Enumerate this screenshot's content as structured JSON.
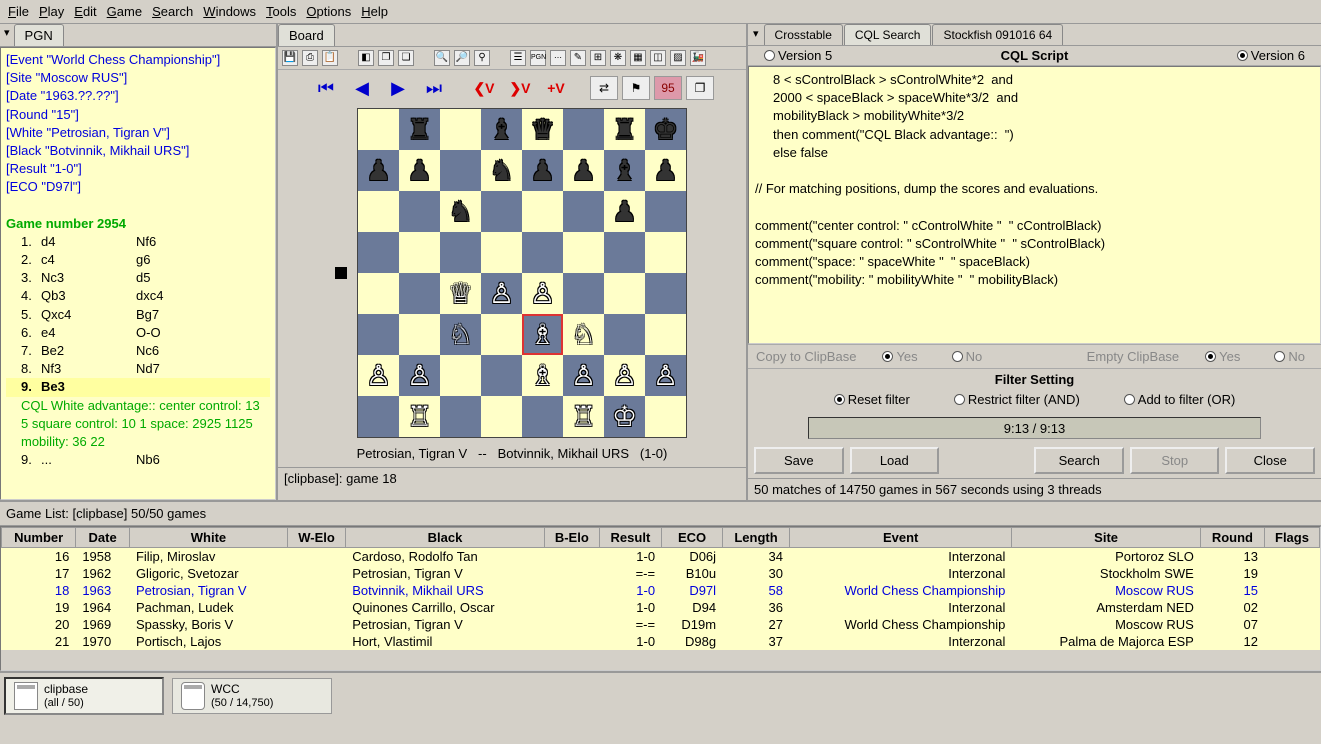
{
  "menu": [
    "File",
    "Play",
    "Edit",
    "Game",
    "Search",
    "Windows",
    "Tools",
    "Options",
    "Help"
  ],
  "pgn": {
    "tab": "PGN",
    "headers": [
      "[Event \"World Chess Championship\"]",
      "[Site \"Moscow RUS\"]",
      "[Date \"1963.??.??\"]",
      "[Round \"15\"]",
      "[White \"Petrosian, Tigran V\"]",
      "[Black \"Botvinnik, Mikhail URS\"]",
      "[Result \"1-0\"]",
      "[ECO \"D97l\"]"
    ],
    "game_number": "Game number 2954",
    "moves": [
      {
        "n": "1.",
        "w": "d4",
        "b": "Nf6"
      },
      {
        "n": "2.",
        "w": "c4",
        "b": "g6"
      },
      {
        "n": "3.",
        "w": "Nc3",
        "b": "d5"
      },
      {
        "n": "4.",
        "w": "Qb3",
        "b": "dxc4"
      },
      {
        "n": "5.",
        "w": "Qxc4",
        "b": "Bg7"
      },
      {
        "n": "6.",
        "w": "e4",
        "b": "O-O"
      },
      {
        "n": "7.",
        "w": "Be2",
        "b": "Nc6"
      },
      {
        "n": "8.",
        "w": "Nf3",
        "b": "Nd7"
      },
      {
        "n": "9.",
        "w": "Be3",
        "b": "",
        "hl": true
      }
    ],
    "cql_comment": "CQL White advantage:: center control: 13 5 square control: 10 1 space: 2925 1125 mobility: 36 22",
    "trailing": {
      "n": "9.",
      "w": "...",
      "b": "Nb6"
    }
  },
  "board": {
    "tab": "Board",
    "caption_w": "Petrosian, Tigran V",
    "caption_sep": "--",
    "caption_b": "Botvinnik, Mikhail URS",
    "caption_res": "(1-0)",
    "status": "[clipbase]: game  18",
    "fen_rows": [
      ".r.bq.rk",
      "pp.nppbp",
      "..n...p.",
      "........",
      "..QPP...",
      "..N.BN..",
      "PP..BPPP",
      ".R...RK."
    ],
    "hl_square": "e3"
  },
  "right": {
    "tabs": [
      "Crosstable",
      "CQL Search",
      "Stockfish 091016 64"
    ],
    "active_tab": 1,
    "version5": "Version 5",
    "version6": "Version 6",
    "title": "CQL Script",
    "cql": "     8 < sControlBlack > sControlWhite*2  and\n     2000 < spaceBlack > spaceWhite*3/2  and\n     mobilityBlack > mobilityWhite*3/2\n     then comment(\"CQL Black advantage::  \")\n     else false\n\n// For matching positions, dump the scores and evaluations.\n\ncomment(\"center control: \" cControlWhite \"  \" cControlBlack)\ncomment(\"square control: \" sControlWhite \"  \" sControlBlack)\ncomment(\"space: \" spaceWhite \"  \" spaceBlack)\ncomment(\"mobility: \" mobilityWhite \"  \" mobilityBlack)",
    "copy_clip": "Copy to ClipBase",
    "yes": "Yes",
    "no": "No",
    "empty_clip": "Empty ClipBase",
    "filter_hdr": "Filter Setting",
    "f_reset": "Reset filter",
    "f_and": "Restrict filter (AND)",
    "f_or": "Add to filter (OR)",
    "progress": "9:13 / 9:13",
    "btn_save": "Save",
    "btn_load": "Load",
    "btn_search": "Search",
    "btn_stop": "Stop",
    "btn_close": "Close",
    "status": "50 matches of 14750 games in 567 seconds using 3 threads"
  },
  "game_list": {
    "title": "Game List: [clipbase] 50/50 games",
    "cols": [
      "Number",
      "Date",
      "White",
      "W-Elo",
      "Black",
      "B-Elo",
      "Result",
      "ECO",
      "Length",
      "Event",
      "Site",
      "Round",
      "Flags"
    ],
    "rows": [
      {
        "num": 16,
        "date": "1958",
        "w": "Filip, Miroslav",
        "we": "",
        "b": "Cardoso, Rodolfo Tan",
        "be": "",
        "res": "1-0",
        "eco": "D06j",
        "len": 34,
        "ev": "Interzonal",
        "site": "Portoroz SLO",
        "rnd": "13",
        "fl": ""
      },
      {
        "num": 17,
        "date": "1962",
        "w": "Gligoric, Svetozar",
        "we": "",
        "b": "Petrosian, Tigran V",
        "be": "",
        "res": "=-=",
        "eco": "B10u",
        "len": 30,
        "ev": "Interzonal",
        "site": "Stockholm SWE",
        "rnd": "19",
        "fl": ""
      },
      {
        "num": 18,
        "date": "1963",
        "w": "Petrosian, Tigran V",
        "we": "",
        "b": "Botvinnik, Mikhail URS",
        "be": "",
        "res": "1-0",
        "eco": "D97l",
        "len": 58,
        "ev": "World Chess Championship",
        "site": "Moscow RUS",
        "rnd": "15",
        "fl": "",
        "sel": true
      },
      {
        "num": 19,
        "date": "1964",
        "w": "Pachman, Ludek",
        "we": "",
        "b": "Quinones Carrillo, Oscar",
        "be": "",
        "res": "1-0",
        "eco": "D94",
        "len": 36,
        "ev": "Interzonal",
        "site": "Amsterdam NED",
        "rnd": "02",
        "fl": ""
      },
      {
        "num": 20,
        "date": "1969",
        "w": "Spassky, Boris V",
        "we": "",
        "b": "Petrosian, Tigran V",
        "be": "",
        "res": "=-=",
        "eco": "D19m",
        "len": 27,
        "ev": "World Chess Championship",
        "site": "Moscow RUS",
        "rnd": "07",
        "fl": ""
      },
      {
        "num": 21,
        "date": "1970",
        "w": "Portisch, Lajos",
        "we": "",
        "b": "Hort, Vlastimil",
        "be": "",
        "res": "1-0",
        "eco": "D98g",
        "len": 37,
        "ev": "Interzonal",
        "site": "Palma de Majorca ESP",
        "rnd": "12",
        "fl": ""
      }
    ]
  },
  "bottom": {
    "db1": {
      "name": "clipbase",
      "sub": "(all / 50)"
    },
    "db2": {
      "name": "WCC",
      "sub": "(50 / 14,750)"
    }
  }
}
